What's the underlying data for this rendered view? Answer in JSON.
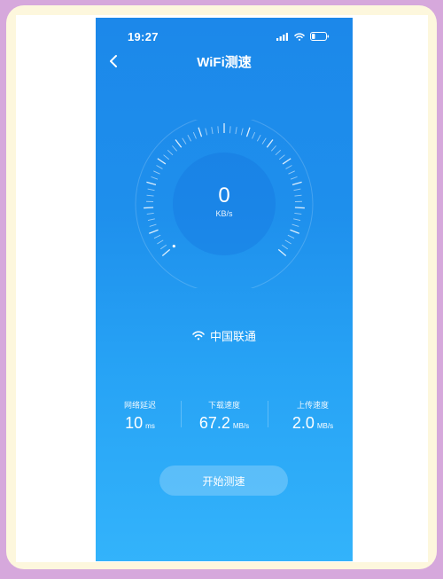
{
  "status_bar": {
    "time": "19:27"
  },
  "nav": {
    "title": "WiFi测速"
  },
  "gauge": {
    "value": "0",
    "unit": "KB/s",
    "needle_fraction": 0.0
  },
  "network": {
    "name": "中国联通"
  },
  "stats": [
    {
      "label": "网络延迟",
      "value": "10",
      "unit": "ms"
    },
    {
      "label": "下载速度",
      "value": "67.2",
      "unit": "MB/s"
    },
    {
      "label": "上传速度",
      "value": "2.0",
      "unit": "MB/s"
    }
  ],
  "actions": {
    "start_label": "开始测速"
  },
  "colors": {
    "primary_blue": "#1e8fec",
    "light_blue": "#33b3fb"
  }
}
